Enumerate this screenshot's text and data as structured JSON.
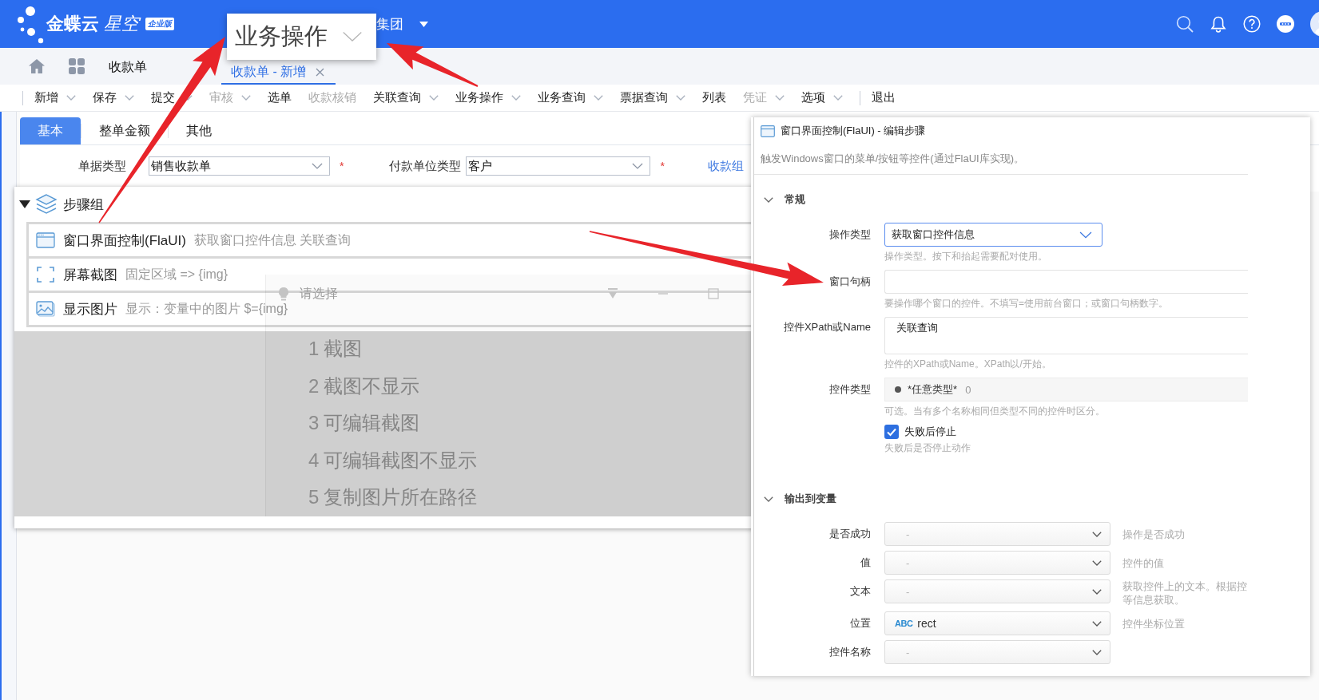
{
  "top_bar": {
    "logo": {
      "brand": "金蝶云",
      "product": "星空",
      "edition": "企业版"
    },
    "org": "集团"
  },
  "callout": {
    "label": "业务操作"
  },
  "tab_bar": {
    "tabs": [
      {
        "label": "收款单",
        "selected": false,
        "closable": false
      },
      {
        "label": "收款单 - 新增",
        "selected": true,
        "closable": true
      }
    ]
  },
  "toolbar": {
    "items": [
      {
        "label": "新增",
        "dropdown": true,
        "disabled": false,
        "separator_before": true
      },
      {
        "label": "保存",
        "dropdown": true,
        "disabled": false,
        "separator_before": false
      },
      {
        "label": "提交",
        "dropdown": true,
        "disabled": false,
        "separator_before": false
      },
      {
        "label": "审核",
        "dropdown": true,
        "disabled": true,
        "separator_before": false
      },
      {
        "label": "选单",
        "dropdown": false,
        "disabled": false,
        "separator_before": false
      },
      {
        "label": "收款核销",
        "dropdown": false,
        "disabled": true,
        "separator_before": false
      },
      {
        "label": "关联查询",
        "dropdown": true,
        "disabled": false,
        "separator_before": false
      },
      {
        "label": "业务操作",
        "dropdown": true,
        "disabled": false,
        "separator_before": false
      },
      {
        "label": "业务查询",
        "dropdown": true,
        "disabled": false,
        "separator_before": false
      },
      {
        "label": "票据查询",
        "dropdown": true,
        "disabled": false,
        "separator_before": false
      },
      {
        "label": "列表",
        "dropdown": false,
        "disabled": false,
        "separator_before": false
      },
      {
        "label": "凭证",
        "dropdown": true,
        "disabled": true,
        "separator_before": false
      },
      {
        "label": "选项",
        "dropdown": true,
        "disabled": false,
        "separator_before": false
      },
      {
        "label": "退出",
        "dropdown": false,
        "disabled": false,
        "separator_before": true
      }
    ]
  },
  "form": {
    "tabs": [
      {
        "label": "基本",
        "selected": true
      },
      {
        "label": "整单金额",
        "selected": false
      },
      {
        "label": "其他",
        "selected": false
      }
    ],
    "fields": [
      {
        "label": "单据类型",
        "value": "销售收款单",
        "required_mark": "*"
      },
      {
        "label": "付款单位类型",
        "value": "客户",
        "required_mark": "*"
      }
    ],
    "link": "收款组"
  },
  "step_panel": {
    "group": {
      "title": "步骤组",
      "expanded": true,
      "steps": [
        {
          "kind": "window",
          "title": "窗口界面控制(FlaUI)",
          "detail": "获取窗口控件信息 关联查询"
        },
        {
          "kind": "screenshot",
          "title": "屏幕截图",
          "detail": "固定区域 => {img}"
        },
        {
          "kind": "image",
          "title": "显示图片",
          "detail": "显示：变量中的图片 $={img}"
        }
      ]
    }
  },
  "selection_menu": {
    "title": "请选择",
    "items": [
      {
        "number": "1",
        "label": "截图"
      },
      {
        "number": "2",
        "label": "截图不显示"
      },
      {
        "number": "3",
        "label": "可编辑截图"
      },
      {
        "number": "4",
        "label": "可编辑截图不显示"
      },
      {
        "number": "5",
        "label": "复制图片所在路径"
      }
    ]
  },
  "edit_panel": {
    "title": "窗口界面控制(FlaUI) - 编辑步骤",
    "description": "触发Windows窗口的菜单/按钮等控件(通过FlaUI库实现)。",
    "sections": [
      {
        "title": "常规",
        "expanded": true,
        "fields": [
          {
            "kind": "select",
            "label": "操作类型",
            "value": "获取窗口控件信息",
            "focused": true,
            "hint": "操作类型。按下和抬起需要配对使用。"
          },
          {
            "kind": "input",
            "label": "窗口句柄",
            "hint": "要操作哪个窗口的控件。不填写=使用前台窗口；或窗口句柄数字。"
          },
          {
            "kind": "textarea",
            "label": "控件XPath或Name",
            "value": "关联查询",
            "hint": "控件的XPath或Name。XPath以/开始。"
          },
          {
            "kind": "type_input",
            "label": "控件类型",
            "value": "*任意类型*",
            "count": "0",
            "hint": "可选。当有多个名称相同但类型不同的控件时区分。"
          },
          {
            "kind": "checkbox",
            "label": "失败后停止",
            "checked": true,
            "hint": "失败后是否停止动作"
          }
        ]
      },
      {
        "title": "输出到变量",
        "expanded": true,
        "fields": [
          {
            "kind": "variable",
            "label": "是否成功",
            "placeholder": "-",
            "hint": "操作是否成功"
          },
          {
            "kind": "variable",
            "label": "值",
            "placeholder": "-",
            "hint": "控件的值"
          },
          {
            "kind": "variable",
            "label": "文本",
            "placeholder": "-",
            "hint": "获取控件上的文本。根据控等信息获取。"
          },
          {
            "kind": "variable",
            "label": "位置",
            "badge": "ABC",
            "value": "rect",
            "hint": "控件坐标位置"
          },
          {
            "kind": "variable",
            "label": "控件名称",
            "placeholder": "-"
          }
        ]
      }
    ]
  }
}
